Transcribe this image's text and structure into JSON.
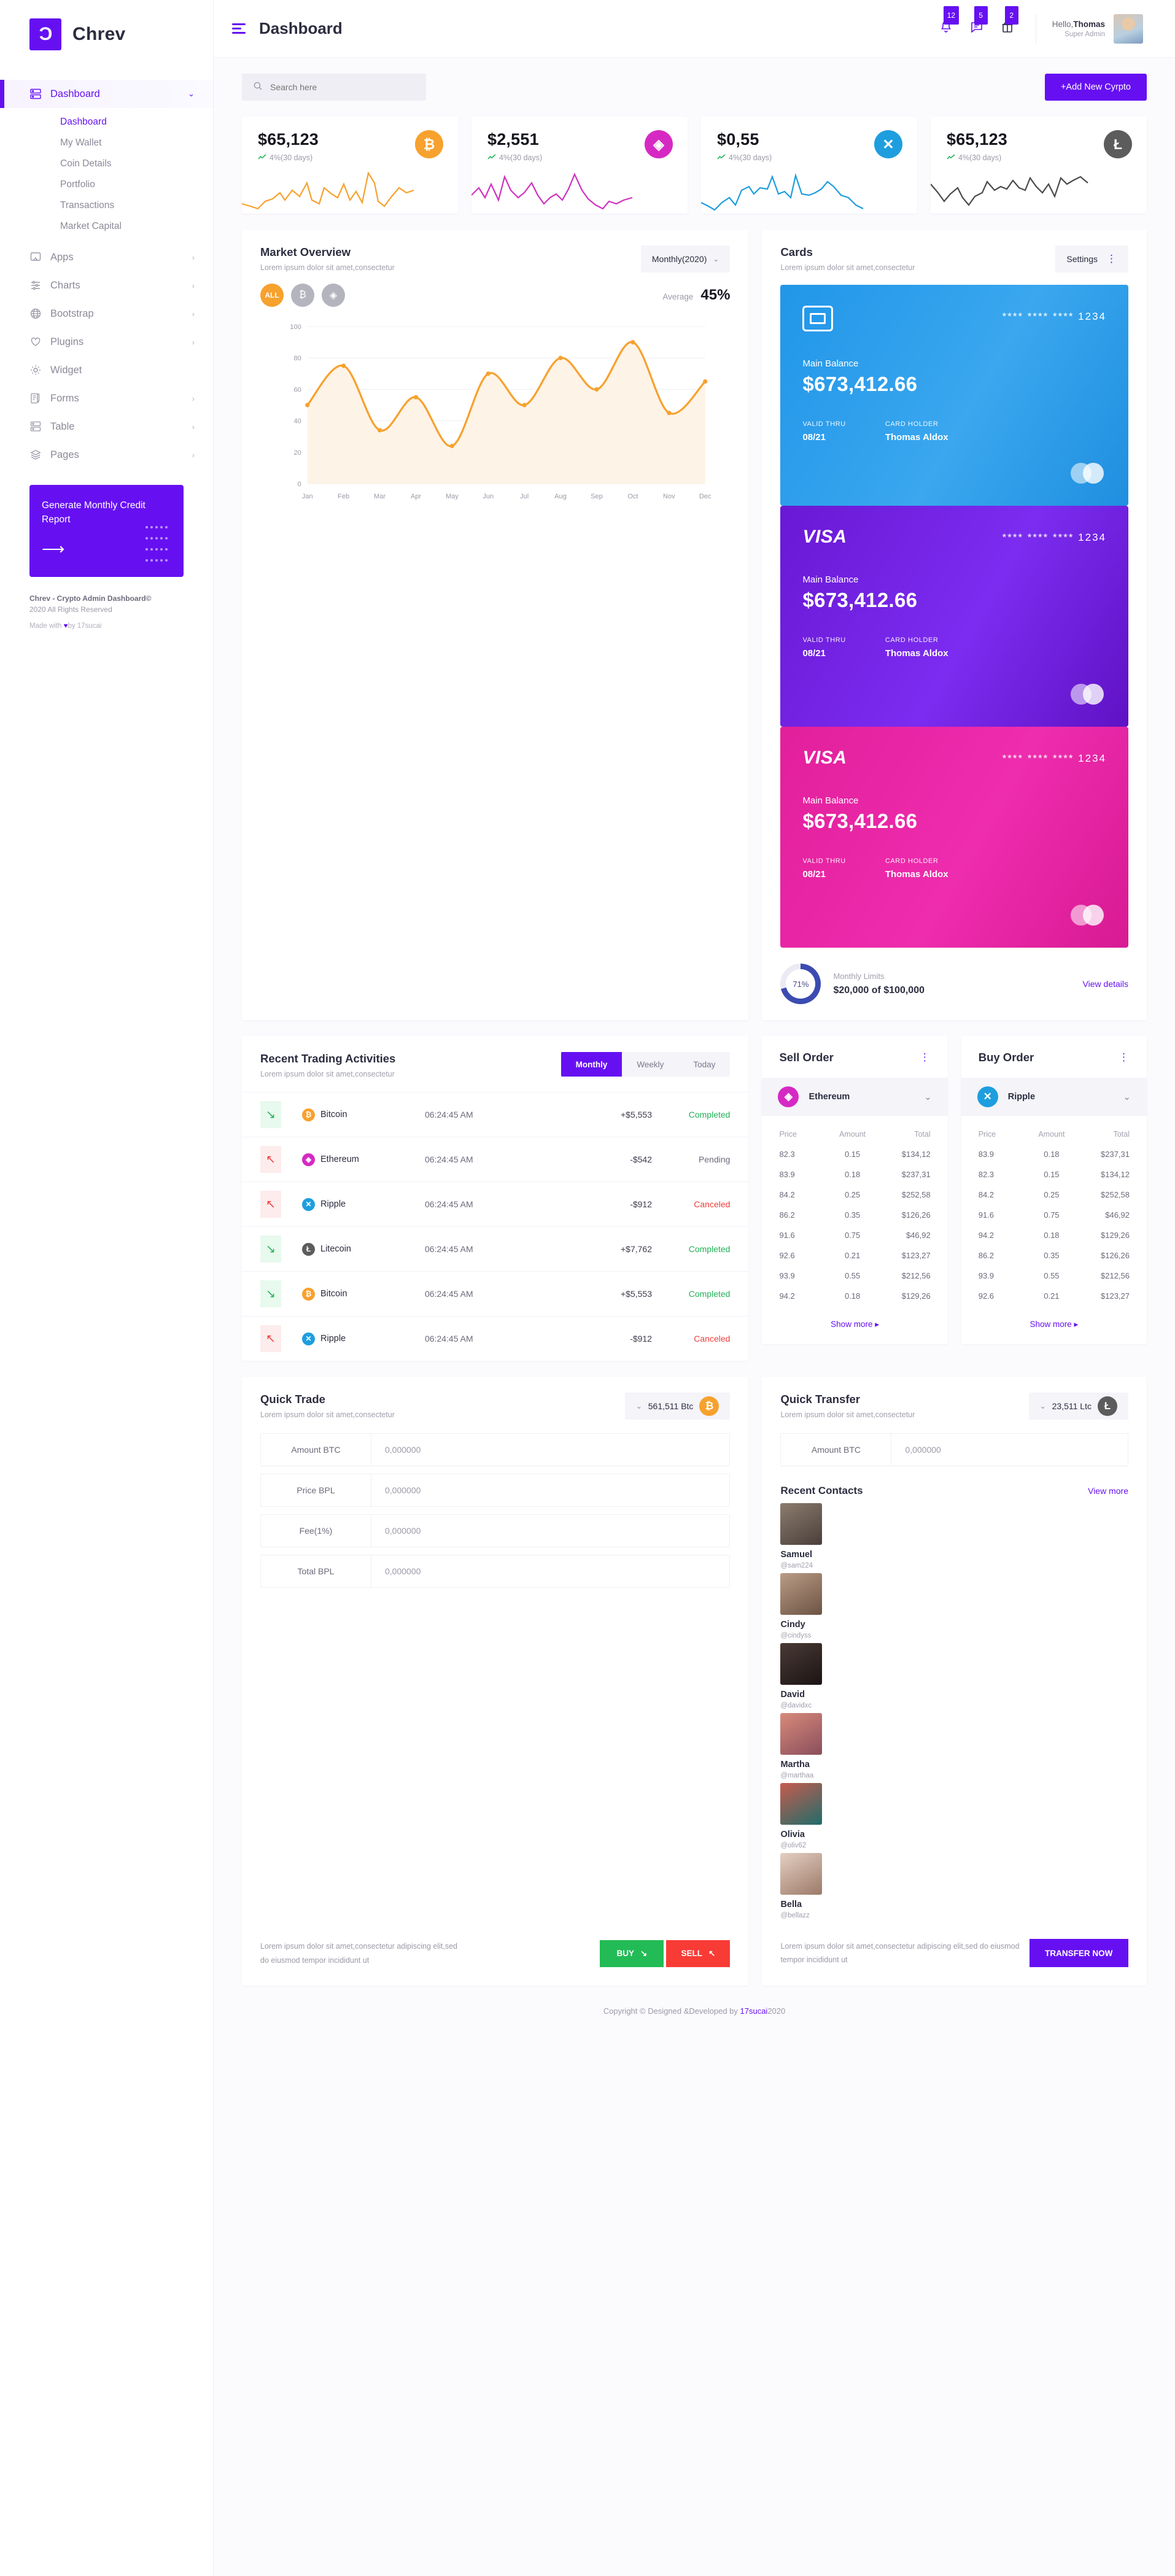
{
  "brand": {
    "logo_glyph": "Ɔ",
    "name": "Chrev"
  },
  "sidebar": {
    "items": [
      {
        "label": "Dashboard",
        "icon": "dashboard-icon",
        "chev": "⌄",
        "active": true
      },
      {
        "label": "Apps",
        "icon": "apps-icon",
        "chev": "›"
      },
      {
        "label": "Charts",
        "icon": "charts-icon",
        "chev": "›"
      },
      {
        "label": "Bootstrap",
        "icon": "globe-icon",
        "chev": "›"
      },
      {
        "label": "Plugins",
        "icon": "heart-icon",
        "chev": "›"
      },
      {
        "label": "Widget",
        "icon": "gear-icon",
        "chev": ""
      },
      {
        "label": "Forms",
        "icon": "forms-icon",
        "chev": "›"
      },
      {
        "label": "Table",
        "icon": "table-icon",
        "chev": "›"
      },
      {
        "label": "Pages",
        "icon": "layers-icon",
        "chev": "›"
      }
    ],
    "subitems": [
      {
        "label": "Dashboard",
        "active": true
      },
      {
        "label": "My Wallet"
      },
      {
        "label": "Coin Details"
      },
      {
        "label": "Portfolio"
      },
      {
        "label": "Transactions"
      },
      {
        "label": "Market Capital"
      }
    ],
    "promo": {
      "title": "Generate Monthly Credit Report",
      "arrow": "⟶"
    },
    "footer": {
      "line1": "Chrev - Crypto Admin Dashboard©",
      "line2": "2020 All Rights Reserved",
      "made_prefix": "Made with ",
      "made_suffix": "by 17sucai"
    }
  },
  "topbar": {
    "title": "Dashboard",
    "icons": [
      {
        "name": "bell-icon",
        "badge": "12"
      },
      {
        "name": "message-icon",
        "badge": "5"
      },
      {
        "name": "gift-icon",
        "badge": "2"
      }
    ],
    "user": {
      "hello_prefix": "Hello,",
      "name": "Thomas",
      "role": "Super Admin"
    }
  },
  "search": {
    "placeholder": "Search here",
    "value": ""
  },
  "add_button": "+Add New Cyrpto",
  "stats": [
    {
      "value": "$65,123",
      "change": "4%(30 days)",
      "coin": "btc",
      "symbol": "₿"
    },
    {
      "value": "$2,551",
      "change": "4%(30 days)",
      "coin": "eth",
      "symbol": "◈"
    },
    {
      "value": "$0,55",
      "change": "4%(30 days)",
      "coin": "xrp",
      "symbol": "✕"
    },
    {
      "value": "$65,123",
      "change": "4%(30 days)",
      "coin": "ltc",
      "symbol": "Ł"
    }
  ],
  "market": {
    "title": "Market Overview",
    "subtitle": "Lorem ipsum dolor sit amet,consectetur",
    "period": "Monthly(2020)",
    "tabs": [
      {
        "label": "ALL",
        "on": true
      },
      {
        "label": "₿"
      },
      {
        "label": "◈"
      }
    ],
    "average_label": "Average",
    "average_value": "45%"
  },
  "chart_data": {
    "type": "area",
    "title": "Market Overview",
    "categories": [
      "Jan",
      "Feb",
      "Mar",
      "Apr",
      "May",
      "Jun",
      "Jul",
      "Aug",
      "Sep",
      "Oct",
      "Nov",
      "Dec"
    ],
    "values": [
      50,
      75,
      34,
      55,
      24,
      70,
      50,
      80,
      60,
      90,
      45,
      65
    ],
    "series": [
      {
        "name": "ALL",
        "values": [
          50,
          75,
          34,
          55,
          24,
          70,
          50,
          80,
          60,
          90,
          45,
          65
        ]
      }
    ],
    "ylim": [
      0,
      100
    ],
    "yticks": [
      0,
      20,
      40,
      60,
      80,
      100
    ],
    "xlabel": "",
    "ylabel": "",
    "grid": true,
    "legend": "none",
    "line_color": "#f7a12e",
    "fill_color": "#fdf3e6"
  },
  "cards": {
    "title": "Cards",
    "subtitle": "Lorem ipsum dolor sit amet,consectetur",
    "settings_label": "Settings",
    "items": [
      {
        "theme": "blue",
        "brand": "chip",
        "number": "**** **** **** 1234",
        "balance_label": "Main Balance",
        "balance": "$673,412.66",
        "valid_label": "VALID THRU",
        "valid": "08/21",
        "holder_label": "CARD HOLDER",
        "holder": "Thomas Aldox"
      },
      {
        "theme": "violet",
        "brand": "VISA",
        "number": "**** **** **** 1234",
        "balance_label": "Main Balance",
        "balance": "$673,412.66",
        "valid_label": "VALID THRU",
        "valid": "08/21",
        "holder_label": "CARD HOLDER",
        "holder": "Thomas Aldox"
      },
      {
        "theme": "pink",
        "brand": "VISA",
        "number": "**** **** **** 1234",
        "balance_label": "Main Balance",
        "balance": "$673,412.66",
        "valid_label": "VALID THRU",
        "valid": "08/21",
        "holder_label": "CARD HOLDER",
        "holder": "Thomas Aldox"
      }
    ],
    "limits": {
      "percent": "71%",
      "label": "Monthly Limits",
      "value": "$20,000 of $100,000",
      "link": "View details"
    }
  },
  "trading": {
    "title": "Recent Trading Activities",
    "subtitle": "Lorem ipsum dolor sit amet,consectetur",
    "tabs": [
      {
        "label": "Monthly",
        "on": true
      },
      {
        "label": "Weekly"
      },
      {
        "label": "Today"
      }
    ],
    "rows": [
      {
        "dir": "up",
        "coin": "Bitcoin",
        "coin_class": "btc",
        "symbol": "₿",
        "time": "06:24:45 AM",
        "amount": "+$5,553",
        "status": "Completed",
        "status_class": "st-completed"
      },
      {
        "dir": "down",
        "coin": "Ethereum",
        "coin_class": "eth",
        "symbol": "◈",
        "time": "06:24:45 AM",
        "amount": "-$542",
        "status": "Pending",
        "status_class": "st-pending"
      },
      {
        "dir": "down",
        "coin": "Ripple",
        "coin_class": "xrp",
        "symbol": "✕",
        "time": "06:24:45 AM",
        "amount": "-$912",
        "status": "Canceled",
        "status_class": "st-canceled"
      },
      {
        "dir": "up",
        "coin": "Litecoin",
        "coin_class": "ltc",
        "symbol": "Ł",
        "time": "06:24:45 AM",
        "amount": "+$7,762",
        "status": "Completed",
        "status_class": "st-completed"
      },
      {
        "dir": "up",
        "coin": "Bitcoin",
        "coin_class": "btc",
        "symbol": "₿",
        "time": "06:24:45 AM",
        "amount": "+$5,553",
        "status": "Completed",
        "status_class": "st-completed"
      },
      {
        "dir": "down",
        "coin": "Ripple",
        "coin_class": "xrp",
        "symbol": "✕",
        "time": "06:24:45 AM",
        "amount": "-$912",
        "status": "Canceled",
        "status_class": "st-canceled"
      }
    ]
  },
  "sell_order": {
    "title": "Sell Order",
    "selected": "Ethereum",
    "selected_class": "eth",
    "selected_symbol": "◈",
    "columns": [
      "Price",
      "Amount",
      "Total"
    ],
    "rows": [
      [
        "82.3",
        "0.15",
        "$134,12"
      ],
      [
        "83.9",
        "0.18",
        "$237,31"
      ],
      [
        "84.2",
        "0.25",
        "$252,58"
      ],
      [
        "86.2",
        "0.35",
        "$126,26"
      ],
      [
        "91.6",
        "0.75",
        "$46,92"
      ],
      [
        "92.6",
        "0.21",
        "$123,27"
      ],
      [
        "93.9",
        "0.55",
        "$212,56"
      ],
      [
        "94.2",
        "0.18",
        "$129,26"
      ]
    ],
    "show_more": "Show more  ▸"
  },
  "buy_order": {
    "title": "Buy Order",
    "selected": "Ripple",
    "selected_class": "xrp",
    "selected_symbol": "✕",
    "columns": [
      "Price",
      "Amount",
      "Total"
    ],
    "rows": [
      [
        "83.9",
        "0.18",
        "$237,31"
      ],
      [
        "82.3",
        "0.15",
        "$134,12"
      ],
      [
        "84.2",
        "0.25",
        "$252,58"
      ],
      [
        "91.6",
        "0.75",
        "$46,92"
      ],
      [
        "94.2",
        "0.18",
        "$129,26"
      ],
      [
        "86.2",
        "0.35",
        "$126,26"
      ],
      [
        "93.9",
        "0.55",
        "$212,56"
      ],
      [
        "92.6",
        "0.21",
        "$123,27"
      ]
    ],
    "show_more": "Show more  ▸"
  },
  "quick_trade": {
    "title": "Quick Trade",
    "subtitle": "Lorem ipsum dolor sit amet,consectetur",
    "balance": "561,511 Btc",
    "balance_coin": "btc",
    "balance_symbol": "₿",
    "fields": [
      {
        "label": "Amount BTC",
        "value": "0,000000"
      },
      {
        "label": "Price BPL",
        "value": "0,000000"
      },
      {
        "label": "Fee(1%)",
        "value": "0,000000"
      },
      {
        "label": "Total BPL",
        "value": "0,000000"
      }
    ],
    "note": "Lorem ipsum dolor sit amet,consectetur adipiscing elit,sed do eiusmod tempor incididunt ut",
    "buy_label": "BUY",
    "sell_label": "SELL"
  },
  "quick_transfer": {
    "title": "Quick Transfer",
    "subtitle": "Lorem ipsum dolor sit amet,consectetur",
    "balance": "23,511 Ltc",
    "balance_coin": "ltc",
    "balance_symbol": "Ł",
    "field": {
      "label": "Amount BTC",
      "value": "0,000000"
    },
    "note": "Lorem ipsum dolor sit amet,consectetur adipiscing elit,sed do eiusmod tempor incididunt ut",
    "transfer_label": "TRANSFER NOW"
  },
  "contacts": {
    "title": "Recent Contacts",
    "view_more": "View more",
    "items": [
      {
        "name": "Samuel",
        "handle": "@sam224",
        "c1": "#8c7c6e",
        "c2": "#4a3f3a"
      },
      {
        "name": "Cindy",
        "handle": "@cindyss",
        "c1": "#b99c86",
        "c2": "#6d5344"
      },
      {
        "name": "David",
        "handle": "@davidxc",
        "c1": "#4a3a35",
        "c2": "#1b1414"
      },
      {
        "name": "Martha",
        "handle": "@marthaa",
        "c1": "#d88a7a",
        "c2": "#8a4e5c"
      },
      {
        "name": "Olivia",
        "handle": "@oliv62",
        "c1": "#c75b4e",
        "c2": "#1f6d6a"
      },
      {
        "name": "Bella",
        "handle": "@bellazz",
        "c1": "#e4cfc2",
        "c2": "#9c7a68"
      }
    ]
  },
  "footer": {
    "text_a": "Copyright © Designed &Developed by ",
    "link": "17sucai",
    "text_b": "2020"
  }
}
